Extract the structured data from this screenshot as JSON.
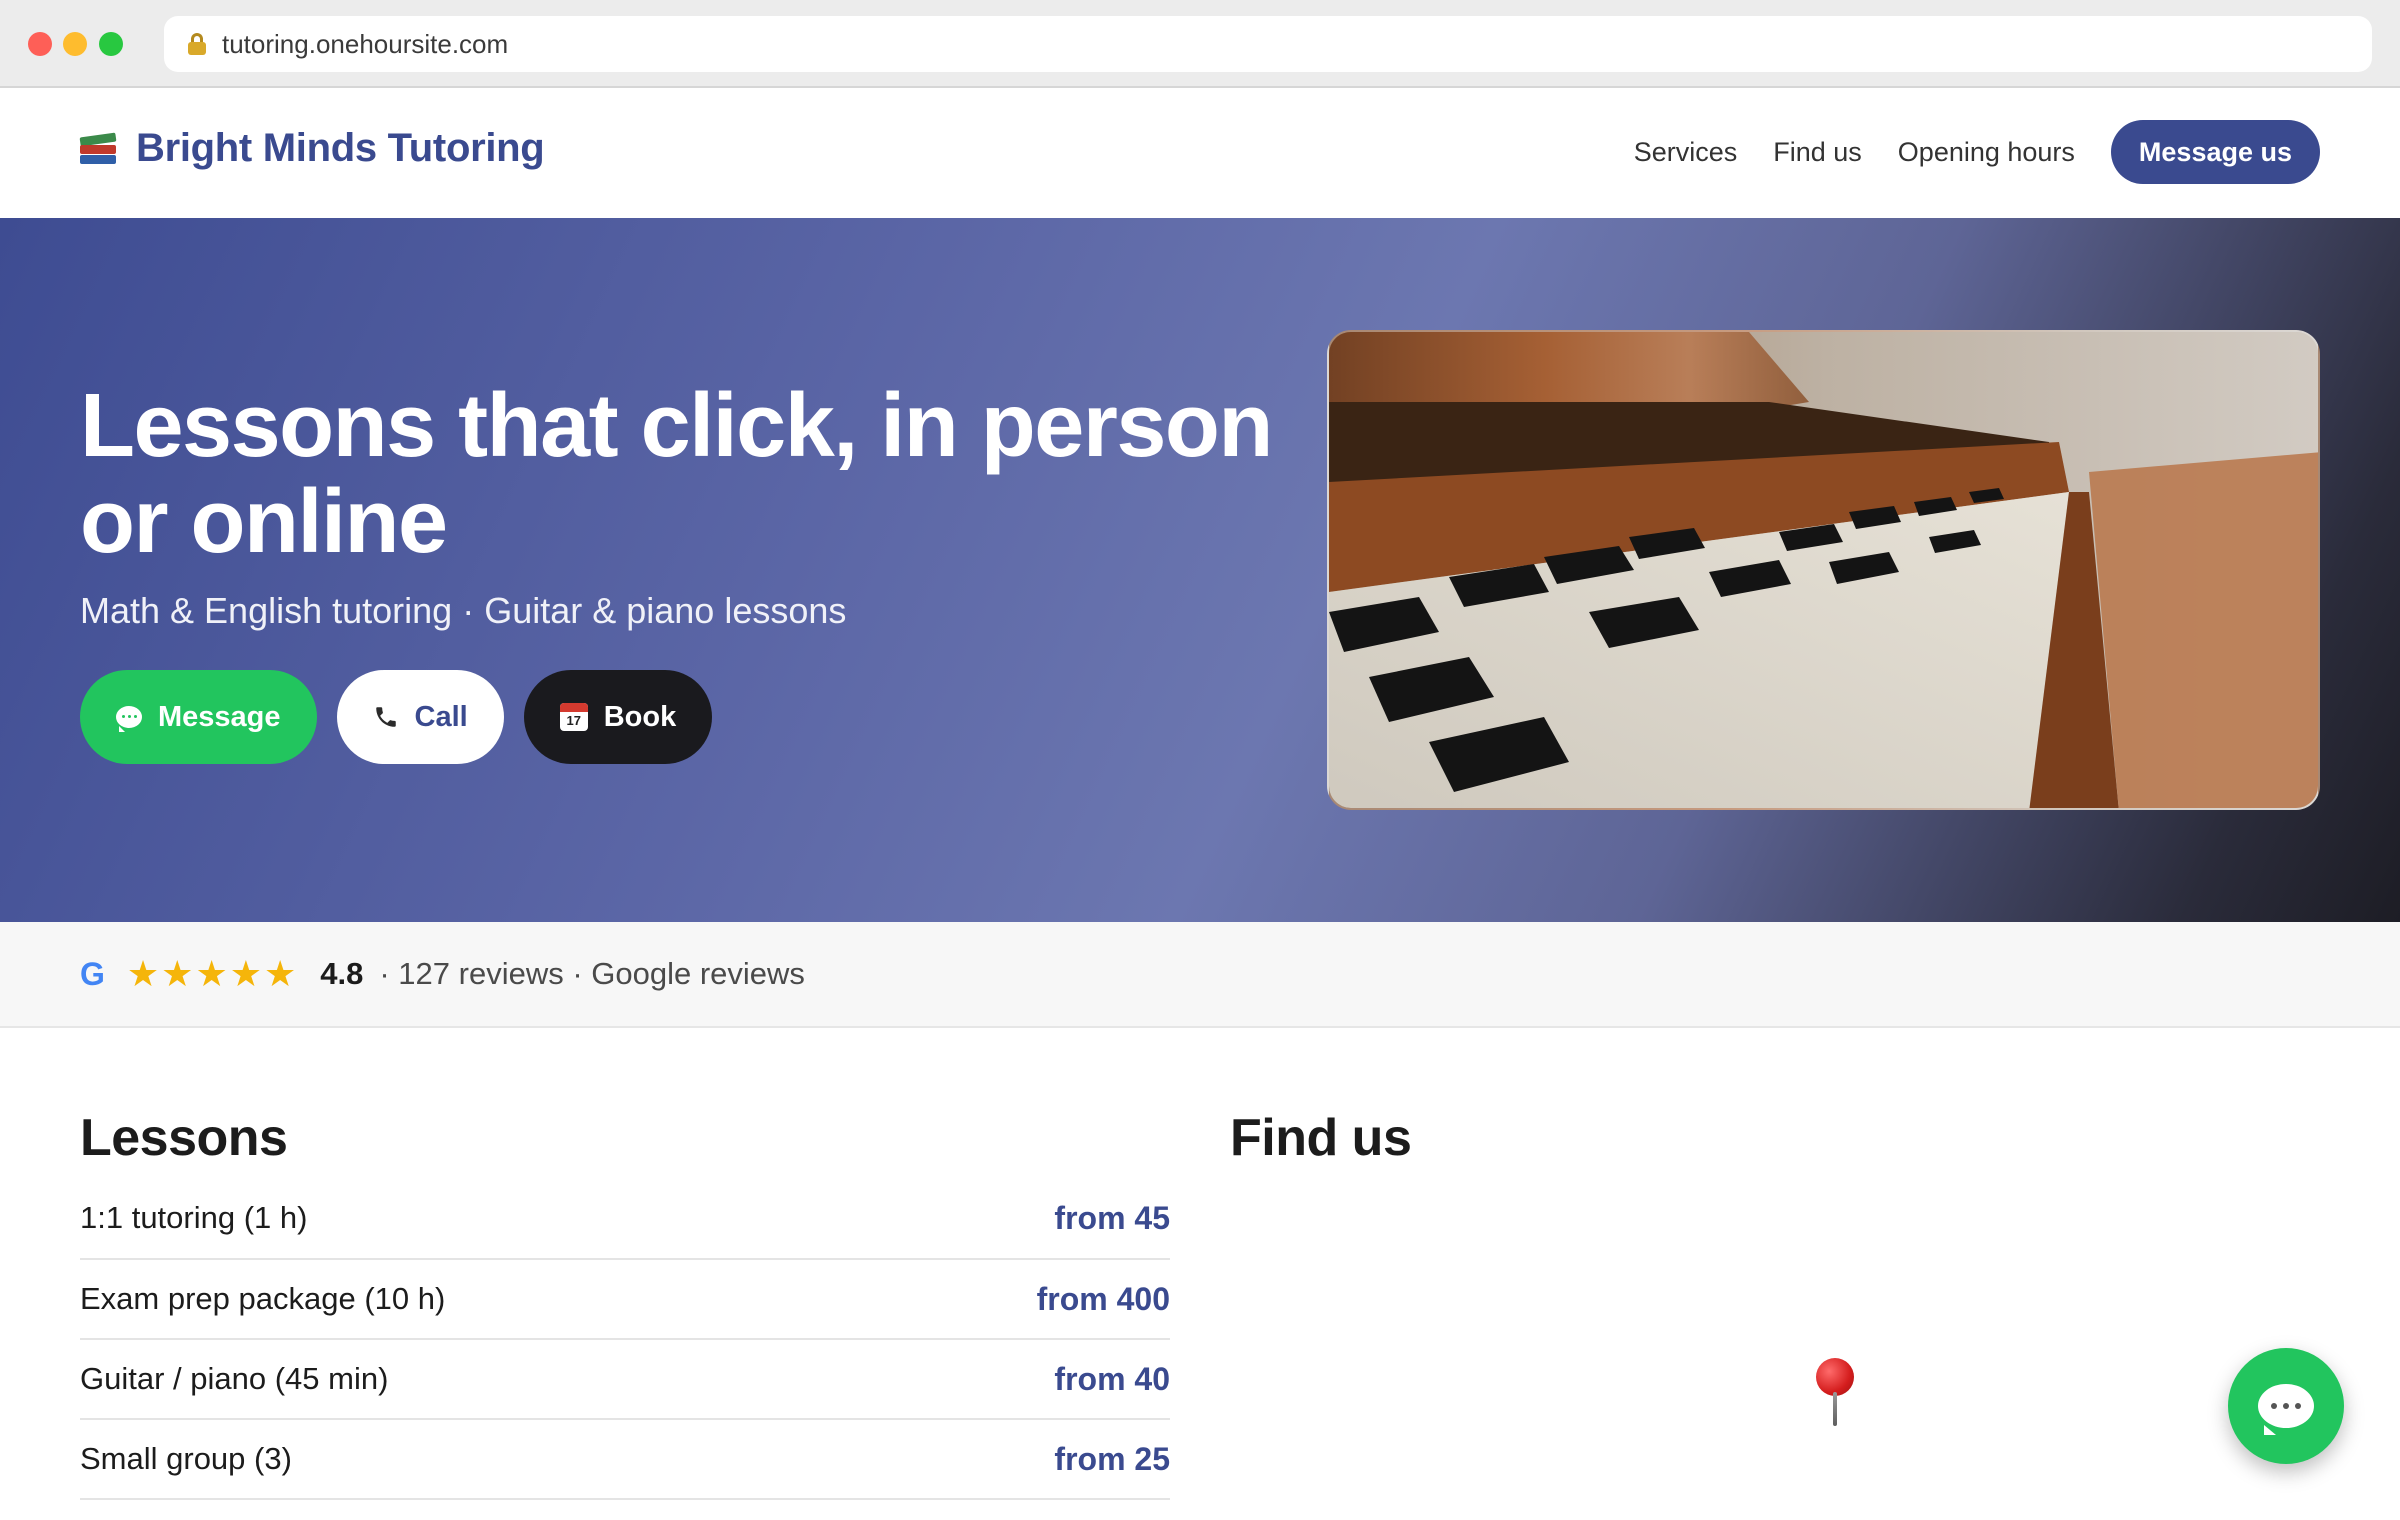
{
  "browser": {
    "url": "tutoring.onehoursite.com"
  },
  "header": {
    "brand": "Bright Minds Tutoring",
    "nav": [
      {
        "label": "Services"
      },
      {
        "label": "Find us"
      },
      {
        "label": "Opening hours"
      }
    ],
    "cta_label": "Message us"
  },
  "hero": {
    "title": "Lessons that click, in person or online",
    "subtitle": "Math & English tutoring · Guitar & piano lessons",
    "buttons": {
      "message": "Message",
      "call": "Call",
      "book": "Book"
    },
    "image_subject": "piano-keys",
    "calendar_number": "17"
  },
  "reviews": {
    "provider_mark": "G",
    "stars": "★★★★★",
    "rating": "4.8",
    "meta": "· 127 reviews · Google reviews"
  },
  "lessons": {
    "title": "Lessons",
    "items": [
      {
        "name": "1:1 tutoring (1 h)",
        "price": "from 45"
      },
      {
        "name": "Exam prep package (10 h)",
        "price": "from 400"
      },
      {
        "name": "Guitar / piano (45 min)",
        "price": "from 40"
      },
      {
        "name": "Small group (3)",
        "price": "from 25"
      }
    ]
  },
  "find_us": {
    "title": "Find us"
  },
  "colors": {
    "brand": "#3a4a8f",
    "whatsapp_green": "#22c55e",
    "star": "#f5b50a"
  }
}
